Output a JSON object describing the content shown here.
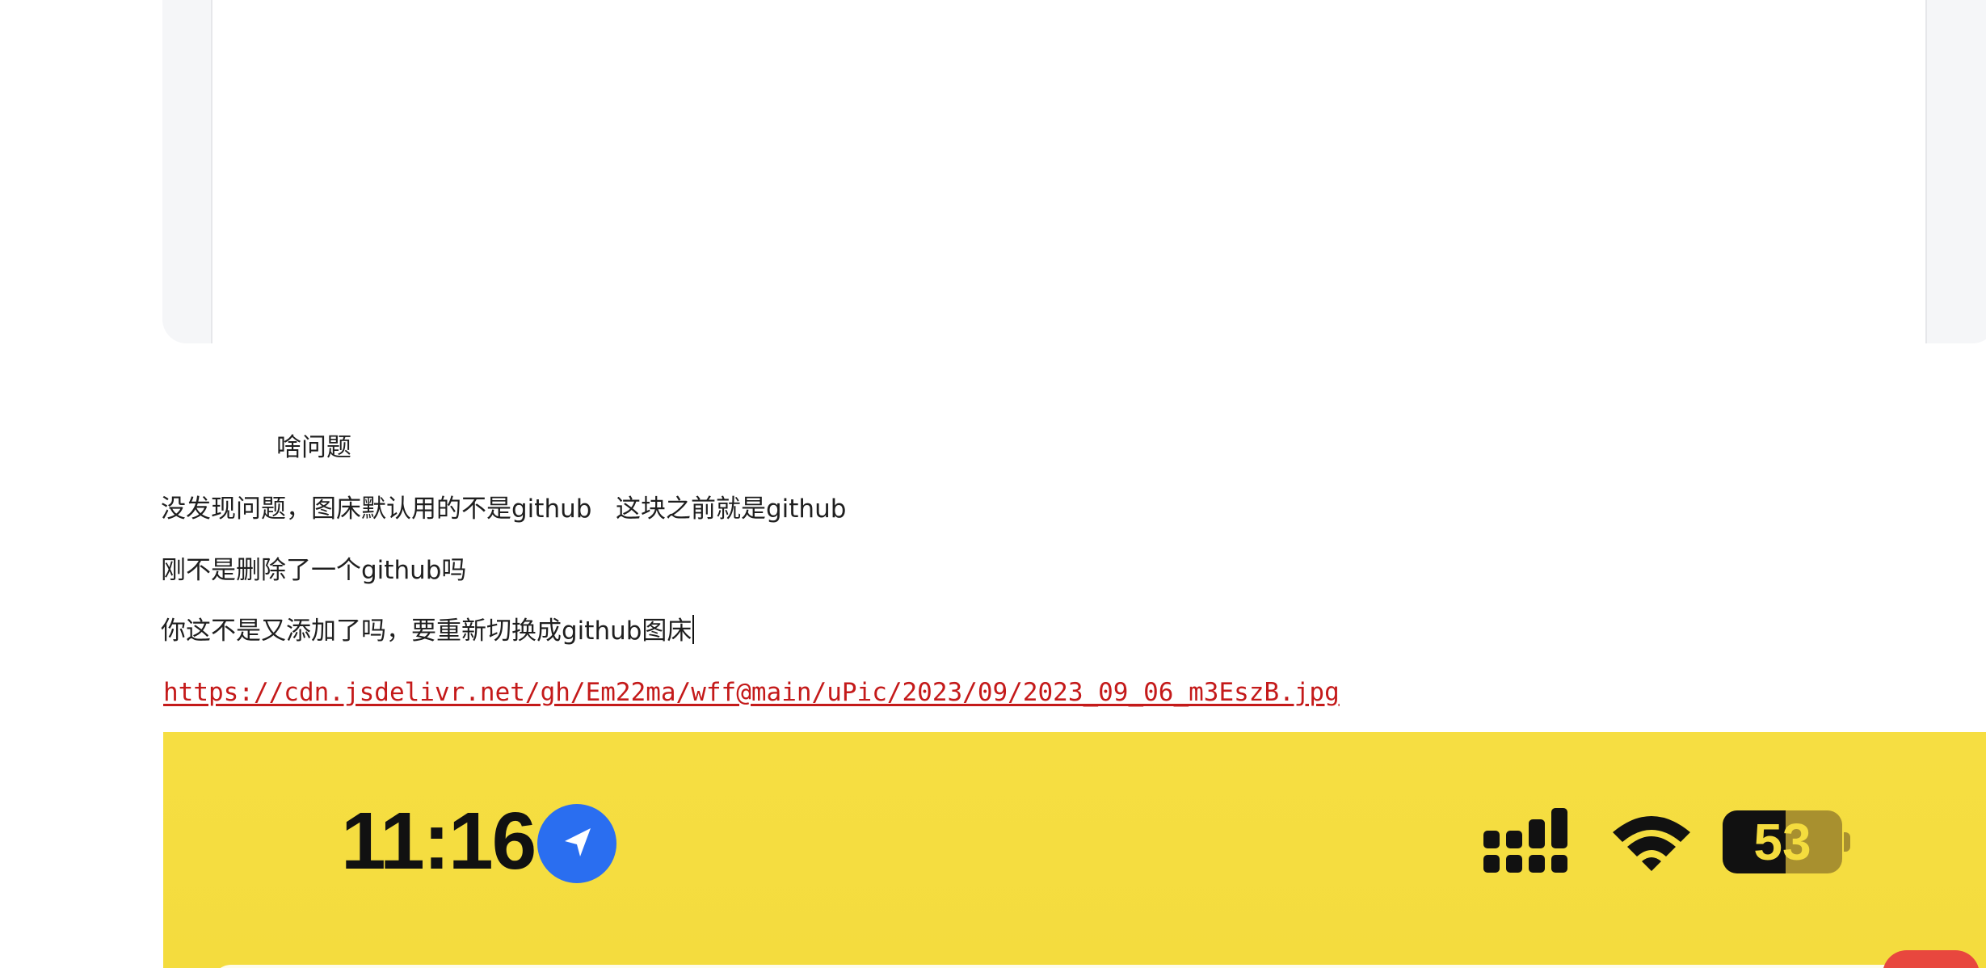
{
  "messages": {
    "line1": "啥问题",
    "line2": "没发现问题，图床默认用的不是github   这块之前就是github",
    "line3": "刚不是删除了一个github吗",
    "line4": "你这不是又添加了吗，要重新切换成github图床"
  },
  "link": {
    "text": "https://cdn.jsdelivr.net/gh/Em22ma/wff@main/uPic/2023/09/2023_09_06_m3EszB.jpg"
  },
  "phone_screenshot": {
    "time": "11:16",
    "battery_level": "53",
    "battery_fraction": 0.53,
    "icons": [
      "location-arrow-icon",
      "cellular-signal-icon",
      "wifi-icon",
      "battery-icon"
    ],
    "colors": {
      "background": "#f4dc3e",
      "location": "#2a6ef0",
      "link": "#c41a1a"
    }
  }
}
